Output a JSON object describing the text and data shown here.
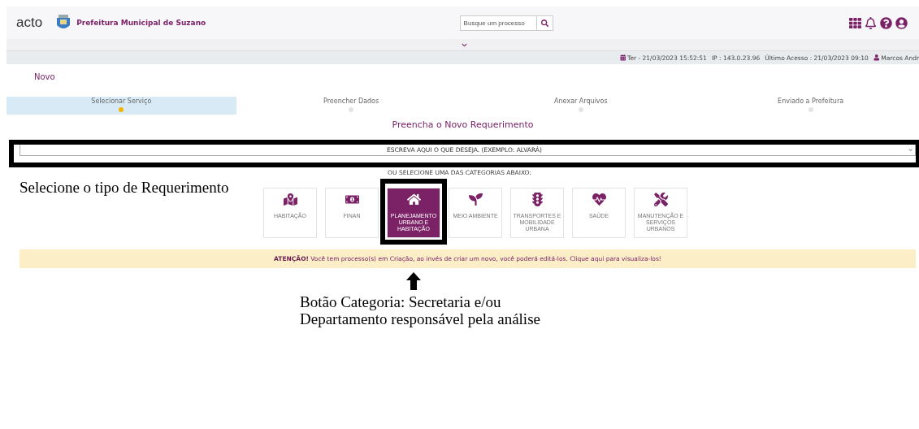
{
  "header": {
    "logo": "acto",
    "org": "Prefeitura Municipal de Suzano",
    "search": {
      "placeholder": "Busque um processo"
    }
  },
  "info_bar": {
    "date": "Ter - 21/03/2023 15:52:51",
    "ip": "IP : 143.0.23.96",
    "last_access": "Último Acesso : 21/03/2023 09:10",
    "user": "Marcos Andr"
  },
  "page_title": "Novo",
  "steps": [
    {
      "label": "Selecionar Serviço",
      "selected": true
    },
    {
      "label": "Preencher Dados",
      "selected": false
    },
    {
      "label": "Anexar Arquivos",
      "selected": false
    },
    {
      "label": "Enviado a Prefeitura",
      "selected": false
    }
  ],
  "form_title": "Preencha o Novo Requerimento",
  "service_select": {
    "placeholder": "ESCREVA AQUI O QUE DESEJA. (EXEMPLO: ALVARÁ)"
  },
  "categories_hint": "OU SELECIONE UMA DAS CATEGORIAS ABAIXO:",
  "categories": [
    {
      "label": "HABITAÇÃO",
      "kind": "map",
      "selected": false
    },
    {
      "label": "FINAN",
      "kind": "money",
      "selected": false
    },
    {
      "label": "PLANEJAMENTO URBANO E HABITAÇÃO",
      "kind": "home",
      "selected": true
    },
    {
      "label": "MEIO AMBIENTE",
      "kind": "nature",
      "selected": false
    },
    {
      "label": "TRANSPORTES E MOBILIDADE URBANA",
      "kind": "traffic",
      "selected": false
    },
    {
      "label": "SAÚDE",
      "kind": "health",
      "selected": false
    },
    {
      "label": "MANUTENÇÃO E SERVIÇOS URBANOS",
      "kind": "tools",
      "selected": false
    }
  ],
  "alert": {
    "text": "**ATENÇÃO!** Você tem processo(s) em Criação, ao invés de criar um novo, você poderá editá-los. Clique aqui para visualiza-los!"
  },
  "annotations": {
    "select_note": "Selecione o tipo de Requerimento",
    "category_note": "Botão Categoria: Secretaria e/ou Departamento responsável pela análise"
  }
}
